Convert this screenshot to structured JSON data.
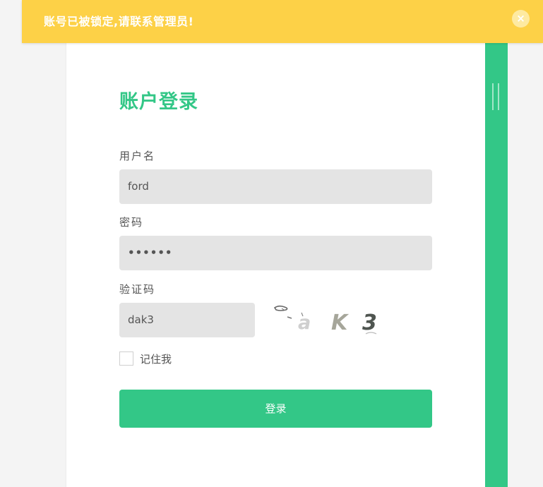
{
  "alert": {
    "message": "账号已被锁定,请联系管理员!",
    "close_glyph": "×",
    "color": "#fdd147"
  },
  "login": {
    "title": "账户登录",
    "username_label": "用户名",
    "username_value": "ford",
    "password_label": "密码",
    "password_value": "••••••",
    "captcha_label": "验证码",
    "captcha_value": "dak3",
    "captcha_chars": [
      "a",
      "K",
      "3"
    ],
    "remember_label": "记住我",
    "remember_checked": false,
    "submit_label": "登录"
  },
  "theme": {
    "accent": "#33c787",
    "input_bg": "#e4e4e4"
  }
}
